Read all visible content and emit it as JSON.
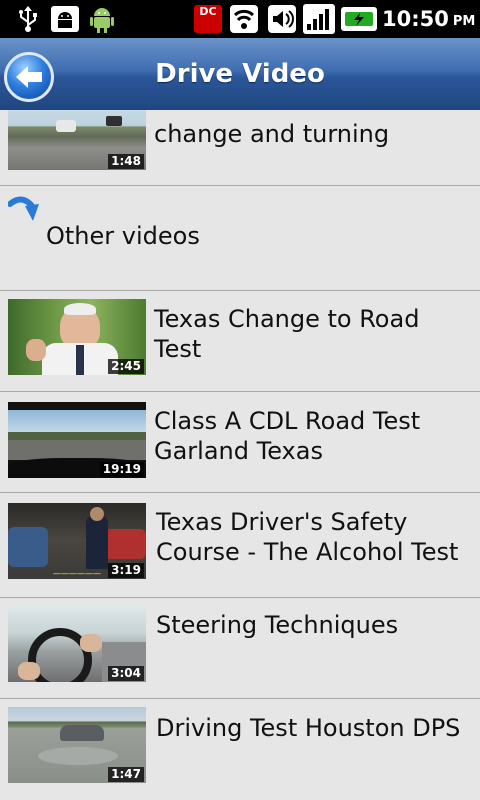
{
  "status": {
    "time": "10:50",
    "ampm": "PM",
    "dc_badge": "DC"
  },
  "header": {
    "title": "Drive Video"
  },
  "list": {
    "partial_item": {
      "title": "change and turning",
      "duration": "1:48"
    },
    "other_videos_label": "Other videos",
    "videos": [
      {
        "title": "Texas Change to Road Test",
        "duration": "2:45"
      },
      {
        "title": "Class A CDL Road Test Garland Texas",
        "duration": "19:19"
      },
      {
        "title": "Texas Driver's Safety Course - The Alcohol Test",
        "duration": "3:19"
      },
      {
        "title": "Steering Techniques",
        "duration": "3:04"
      },
      {
        "title": "Driving Test Houston DPS",
        "duration": "1:47"
      }
    ]
  },
  "colors": {
    "header": "#2b5699",
    "list_bg": "#e6e6e6",
    "divider": "#a9a9a9"
  }
}
